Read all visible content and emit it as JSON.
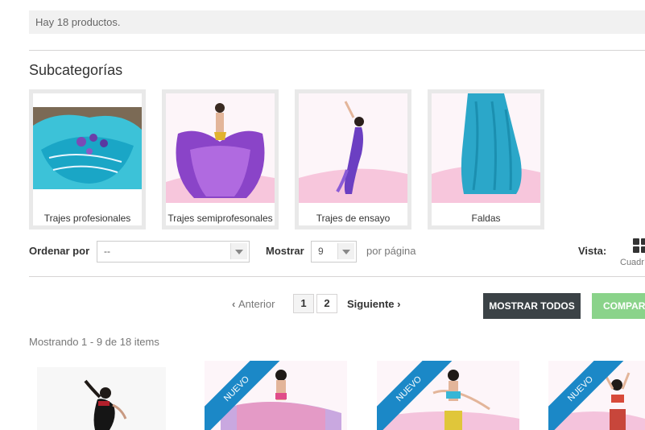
{
  "product_count_text": "Hay 18 productos.",
  "subcategories": {
    "title": "Subcategorías",
    "items": [
      {
        "label": "Trajes profesionales"
      },
      {
        "label": "Trajes semiprofesonales"
      },
      {
        "label": "Trajes de ensayo"
      },
      {
        "label": "Faldas"
      }
    ]
  },
  "controls": {
    "sort_label": "Ordenar por",
    "sort_value": "--",
    "show_label": "Mostrar",
    "show_value": "9",
    "per_page_label": "por página",
    "view_label": "Vista:",
    "view_grid_label": "Cuadrícula"
  },
  "pagination": {
    "prev_label": "Anterior",
    "pages": [
      "1",
      "2"
    ],
    "next_label": "Siguiente",
    "show_all_label": "MOSTRAR TODOS",
    "compare_label": "COMPARAR"
  },
  "showing_text": "Mostrando 1 - 9 de 18 items",
  "products": [
    {
      "badge": ""
    },
    {
      "badge": "NUEVO"
    },
    {
      "badge": "NUEVO"
    },
    {
      "badge": "NUEVO"
    }
  ],
  "colors": {
    "accent_blue": "#1b88c7",
    "dark_button": "#3b4246",
    "green_button": "#8ad38a"
  }
}
